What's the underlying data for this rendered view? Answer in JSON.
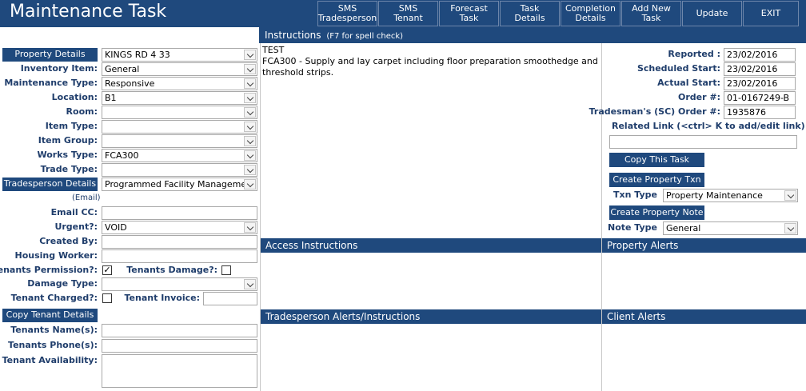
{
  "app": {
    "title": "Maintenance Task"
  },
  "toolbar": {
    "sms_tradesperson": "SMS\nTradesperson",
    "sms_tenant": "SMS\nTenant",
    "forecast_task": "Forecast\nTask",
    "task_details": "Task\nDetails",
    "completion_details": "Completion\nDetails",
    "add_new_task": "Add New\nTask",
    "update": "Update",
    "exit": "EXIT"
  },
  "instructions": {
    "header": "Instructions",
    "hint": "(F7 for spell check)",
    "text": "TEST\nFCA300 - Supply and lay carpet including floor preparation smoothedge and\nthreshold strips."
  },
  "left": {
    "property_details_btn": "Property Details",
    "property_value": "KINGS RD 4 33",
    "inventory_item_label": "Inventory Item:",
    "inventory_item_value": "General",
    "maintenance_type_label": "Maintenance Type:",
    "maintenance_type_value": "Responsive",
    "location_label": "Location:",
    "location_value": "B1",
    "room_label": "Room:",
    "room_value": "",
    "item_type_label": "Item Type:",
    "item_type_value": "",
    "item_group_label": "Item Group:",
    "item_group_value": "",
    "works_type_label": "Works Type:",
    "works_type_value": "FCA300",
    "trade_type_label": "Trade Type:",
    "trade_type_value": "",
    "tradesperson_details_btn": "Tradesperson Details",
    "tradesperson_value": "Programmed Facility Management",
    "email_label": "(Email)",
    "email_cc_label": "Email CC:",
    "email_cc_value": "",
    "urgent_label": "Urgent?:",
    "urgent_value": "VOID",
    "created_by_label": "Created By:",
    "created_by_value": "",
    "housing_worker_label": "Housing Worker:",
    "housing_worker_value": "",
    "tenants_permission_label": "Tenants Permission?:",
    "tenants_permission_checked": "✓",
    "tenants_damage_label": "Tenants Damage?:",
    "damage_type_label": "Damage Type:",
    "damage_type_value": "",
    "tenant_charged_label": "Tenant Charged?:",
    "tenant_invoice_label": "Tenant Invoice:",
    "tenant_invoice_value": "",
    "copy_tenant_btn": "Copy Tenant Details",
    "tenants_names_label": "Tenants Name(s):",
    "tenants_phone_label": "Tenants Phone(s):",
    "tenant_availability_label": "Tenant Availability:"
  },
  "right": {
    "reported_label": "Reported :",
    "reported_value": "23/02/2016",
    "scheduled_start_label": "Scheduled Start:",
    "scheduled_start_value": "23/02/2016",
    "actual_start_label": "Actual Start:",
    "actual_start_value": "23/02/2016",
    "order_label": "Order #:",
    "order_value": "01-0167249-B",
    "sc_order_label": "Tradesman's (SC) Order #:",
    "sc_order_value": "1935876",
    "related_link_label": "Related Link (<ctrl> K to add/edit link)",
    "related_link_value": "",
    "copy_task_btn": "Copy This Task",
    "create_txn_btn": "Create Property Txn",
    "txn_type_label": "Txn Type",
    "txn_type_value": "Property Maintenance",
    "create_note_btn": "Create Property Note",
    "note_type_label": "Note Type",
    "note_type_value": "General"
  },
  "panels": {
    "access_instructions": "Access Instructions",
    "property_alerts": "Property Alerts",
    "tradesperson_alerts": "Tradesperson Alerts/Instructions",
    "client_alerts": "Client Alerts"
  }
}
